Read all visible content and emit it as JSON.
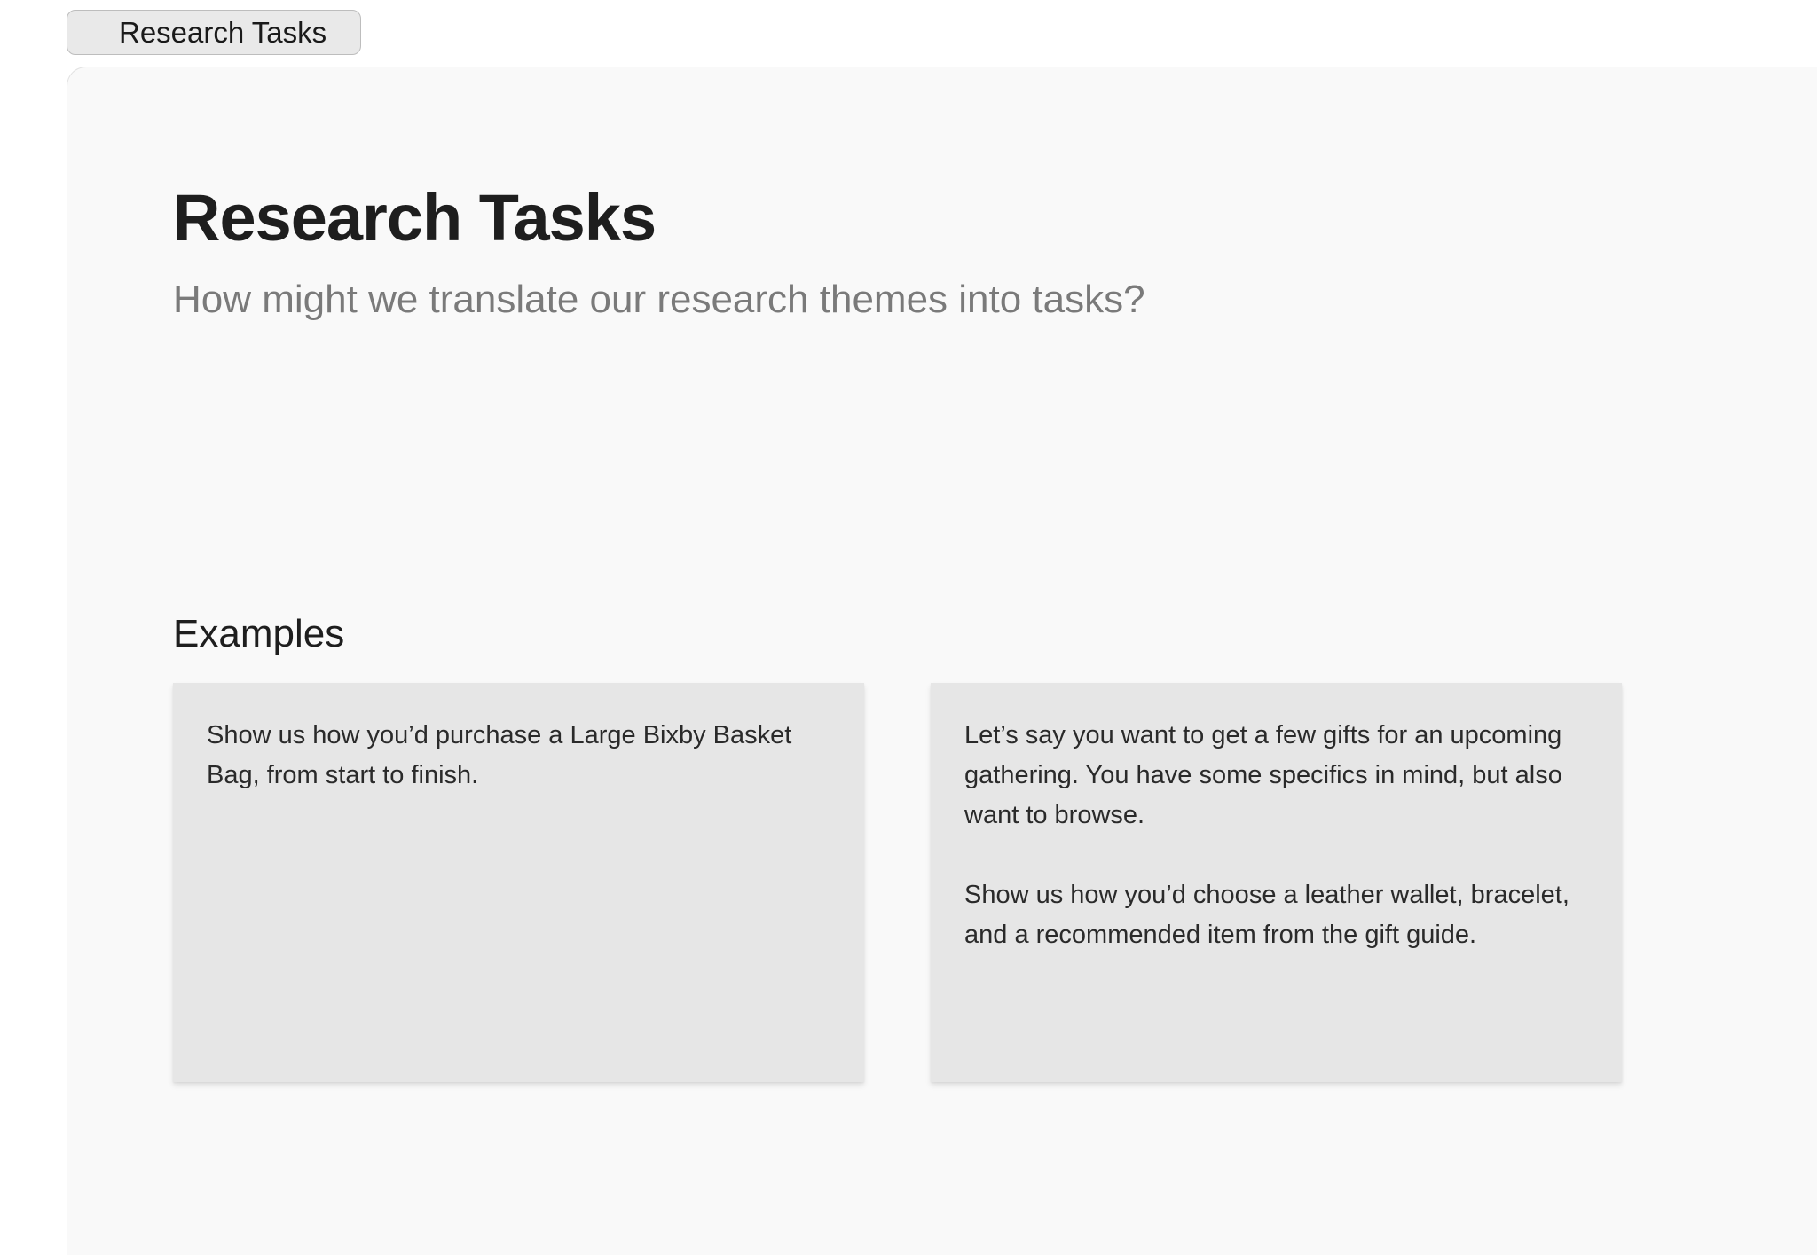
{
  "frame_tab": {
    "label": "Research Tasks"
  },
  "board": {
    "title": "Research Tasks",
    "subtitle": "How might we translate our research themes into tasks?",
    "examples_heading": "Examples",
    "cards": [
      {
        "paragraphs": [
          "Show us how you’d purchase a Large Bixby Basket Bag, from start to finish."
        ]
      },
      {
        "paragraphs": [
          "Let’s say you want to get a few gifts for an upcoming gathering. You have some specifics in mind, but also want to browse.",
          "Show us how you’d choose a leather wallet, bracelet, and a recommended item from the gift guide."
        ]
      }
    ]
  },
  "colors": {
    "canvas_background": "#f9f9f9",
    "sticky_note": "#e6e6e6",
    "title_text": "#1e1e1e",
    "subtitle_text": "#7a7a7a"
  }
}
